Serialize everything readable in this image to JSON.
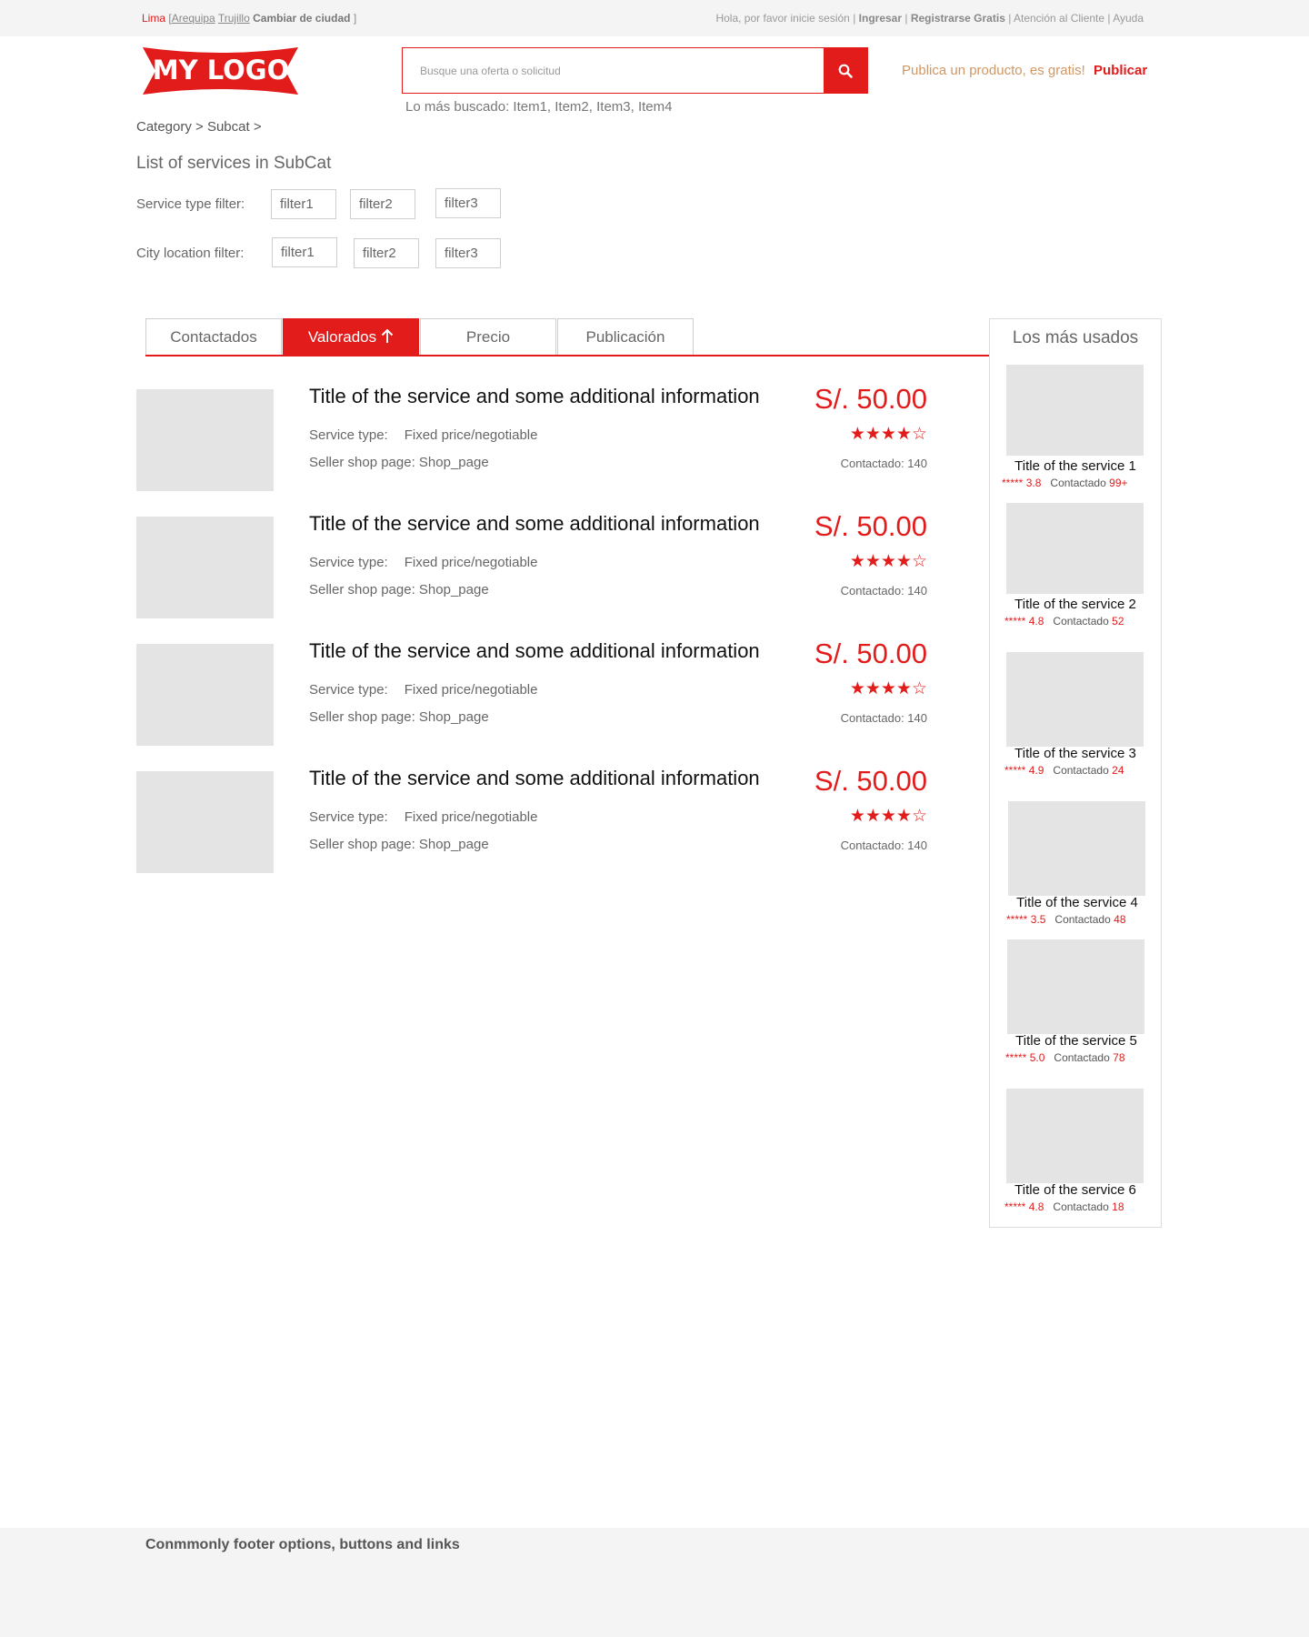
{
  "topbar": {
    "city_current": "Lima",
    "bracket_open": " [",
    "city_link_1": "Arequipa",
    "city_link_2": "Trujillo",
    "change_city": "Cambiar de ciudad",
    "bracket_close": " ]",
    "greeting": "Hola, por favor inicie sesión",
    "login": "Ingresar",
    "register": "Registrarse Gratis",
    "support": "Atención al Cliente",
    "help": "Ayuda",
    "sep": " | "
  },
  "header": {
    "logo_text": "MY LOGO",
    "search_placeholder": "Busque una oferta o solicitud",
    "popular": "Lo más buscado: Item1, Item2, Item3, Item4",
    "publish_prompt": "Publica un producto, es gratis!",
    "publish_link": "Publicar"
  },
  "breadcrumb": "Category > Subcat >",
  "list_title": "List of services in SubCat",
  "filters": {
    "service_type": {
      "label": "Service type filter:",
      "options": [
        "filter1",
        "filter2",
        "filter3"
      ]
    },
    "city_location": {
      "label": "City location filter:",
      "options": [
        "filter1",
        "filter2",
        "filter3"
      ]
    }
  },
  "tabs": [
    "Contactados",
    "Valorados",
    "Precio",
    "Publicación"
  ],
  "active_tab": "Valorados",
  "listings": [
    {
      "title": "Title of the service and some additional information",
      "service_type_label": "Service type:",
      "service_type": "Fixed price/negotiable",
      "shop_label": "Seller shop page:",
      "shop": "Shop_page",
      "price": "S/. 50.00",
      "stars": "★★★★☆",
      "contacted": "Contactado: 140"
    },
    {
      "title": "Title of the service and some additional information",
      "service_type_label": "Service type:",
      "service_type": "Fixed price/negotiable",
      "shop_label": "Seller shop page:",
      "shop": "Shop_page",
      "price": "S/. 50.00",
      "stars": "★★★★☆",
      "contacted": "Contactado: 140"
    },
    {
      "title": "Title of the service and some additional information",
      "service_type_label": "Service type:",
      "service_type": "Fixed price/negotiable",
      "shop_label": "Seller shop page:",
      "shop": "Shop_page",
      "price": "S/. 50.00",
      "stars": "★★★★☆",
      "contacted": "Contactado: 140"
    },
    {
      "title": "Title of the service and some additional information",
      "service_type_label": "Service type:",
      "service_type": "Fixed price/negotiable",
      "shop_label": "Seller shop page:",
      "shop": "Shop_page",
      "price": "S/. 50.00",
      "stars": "★★★★☆",
      "contacted": "Contactado: 140"
    }
  ],
  "sidebar": {
    "heading": "Los más usados",
    "items": [
      {
        "title": "Title of the service 1",
        "stars": "*****",
        "rating": "3.8",
        "contact_label": "Contactado",
        "contacts": "99+"
      },
      {
        "title": "Title of the service 2",
        "stars": "*****",
        "rating": "4.8",
        "contact_label": "Contactado",
        "contacts": "52"
      },
      {
        "title": "Title of the service 3",
        "stars": "*****",
        "rating": "4.9",
        "contact_label": "Contactado",
        "contacts": "24"
      },
      {
        "title": "Title of the service 4",
        "stars": "*****",
        "rating": "3.5",
        "contact_label": "Contactado",
        "contacts": "48"
      },
      {
        "title": "Title of the service 5",
        "stars": "*****",
        "rating": "5.0",
        "contact_label": "Contactado",
        "contacts": "78"
      },
      {
        "title": "Title of the service 6",
        "stars": "*****",
        "rating": "4.8",
        "contact_label": "Contactado",
        "contacts": "18"
      }
    ]
  },
  "footer": {
    "text": "Conmmonly footer options, buttons and links"
  },
  "colors": {
    "accent": "#e21b1b",
    "placeholder_gray": "#e4e4e4",
    "publish_prompt": "#cf9764"
  },
  "icons": {
    "search": "search-icon",
    "sort_arrow": "arrow-up-icon"
  }
}
